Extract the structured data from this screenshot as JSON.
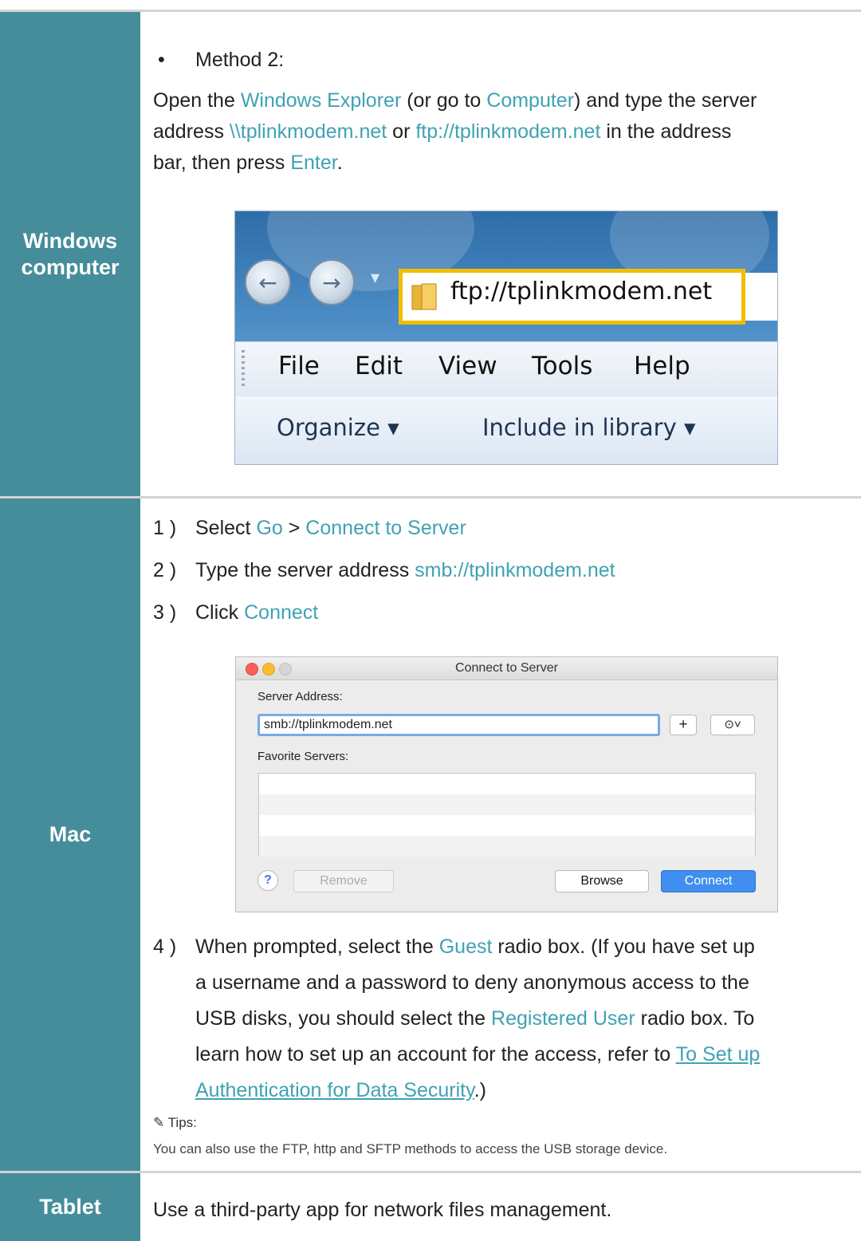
{
  "windows": {
    "label": "Windows computer",
    "bullet": "•",
    "method_title": "Method 2:",
    "p_open": "Open the ",
    "p_windows_explorer": "Windows Explorer",
    "p_or_go_to": " (or go to ",
    "p_computer": "Computer",
    "p_and_type": ") and type the server",
    "p_address": "address ",
    "p_unc": "\\\\tplinkmodem.net",
    "p_or": " or ",
    "p_ftp": "ftp://tplinkmodem.net",
    "p_in_the_address": " in the address",
    "p_bar": "bar, then press ",
    "p_enter": "Enter",
    "p_period": ".",
    "screenshot": {
      "back_icon": "←",
      "forward_icon": "→",
      "dropdown_icon": "▾",
      "address_value": "ftp://tplinkmodem.net",
      "menu": [
        "File",
        "Edit",
        "View",
        "Tools",
        "Help"
      ],
      "organize": "Organize ▾",
      "include_library": "Include in library ▾"
    }
  },
  "mac": {
    "label": "Mac",
    "s1_num": "1 )",
    "s1_a": "Select ",
    "s1_go": "Go",
    "s1_b": " > ",
    "s1_connect_server": "Connect to Server",
    "s2_num": "2 )",
    "s2_a": "Type the server address ",
    "s2_smb": "smb://tplinkmodem.net",
    "s3_num": "3 )",
    "s3_a": "Click ",
    "s3_connect": "Connect",
    "dialog": {
      "title": "Connect to Server",
      "server_address_label": "Server Address:",
      "server_address_value": "smb://tplinkmodem.net",
      "plus": "+",
      "history_icon": "⊙˅",
      "favorite_servers_label": "Favorite Servers:",
      "help": "?",
      "remove": "Remove",
      "browse": "Browse",
      "connect": "Connect"
    },
    "s4_num": "4 )",
    "s4_l1_a": "When prompted, select the ",
    "s4_guest": "Guest",
    "s4_l1_b": " radio box. (If you have set up",
    "s4_l2": "a username and a password to deny anonymous access to the",
    "s4_l3_a": "USB disks, you should select the ",
    "s4_registered": "Registered User",
    "s4_l3_b": " radio box. To",
    "s4_l4_a": "learn how to set up an account for the access, refer to ",
    "s4_link1": "To Set up",
    "s4_link2": "Authentication for Data Security",
    "s4_l5_b": ".)",
    "tips_icon": "✎",
    "tips_title": "Tips:",
    "tips_body": "You can also use the FTP, http and SFTP methods to access the USB storage device."
  },
  "tablet": {
    "label": "Tablet",
    "text": "Use a third-party app for network files management."
  }
}
